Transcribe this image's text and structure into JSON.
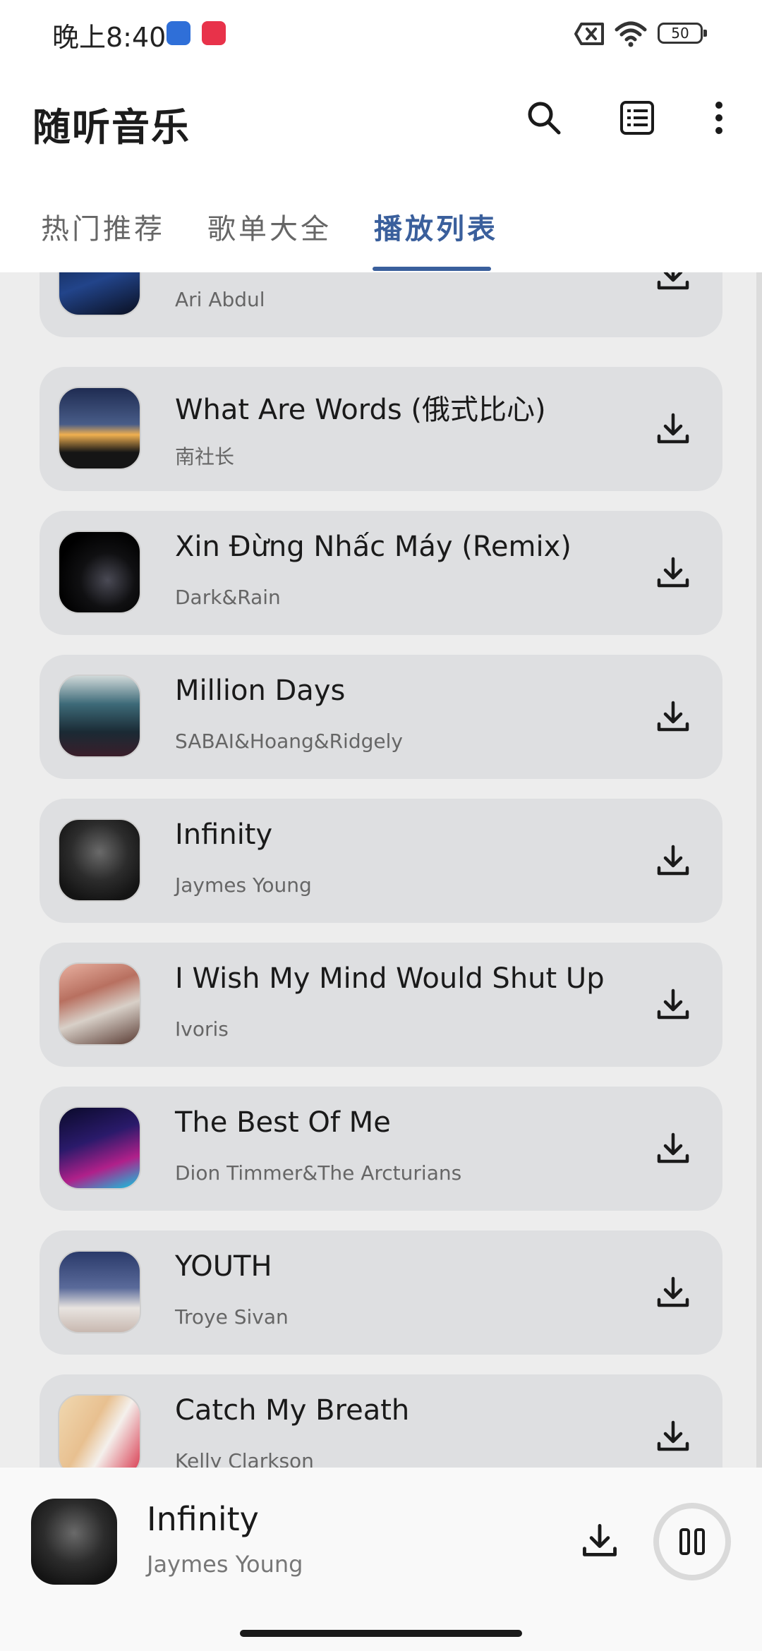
{
  "status_bar": {
    "time": "晚上8:40",
    "battery": "50"
  },
  "app": {
    "title": "随听音乐",
    "tabs": [
      {
        "label": "热门推荐"
      },
      {
        "label": "歌单大全"
      },
      {
        "label": "播放列表"
      }
    ],
    "active_tab": "播放列表"
  },
  "playlist": [
    {
      "title": "",
      "artist": "Ari Abdul"
    },
    {
      "title": "What Are Words (俄式比心)",
      "artist": "南社长"
    },
    {
      "title": "Xin Đừng Nhấc Máy (Remix)",
      "artist": "Dark&Rain"
    },
    {
      "title": "Million Days",
      "artist": "SABAI&Hoang&Ridgely"
    },
    {
      "title": "Infinity",
      "artist": "Jaymes Young"
    },
    {
      "title": "I Wish My Mind Would Shut Up",
      "artist": "Ivoris"
    },
    {
      "title": "The Best Of Me",
      "artist": "Dion Timmer&The Arcturians"
    },
    {
      "title": "YOUTH",
      "artist": "Troye Sivan"
    },
    {
      "title": "Catch My Breath",
      "artist": "Kelly Clarkson"
    }
  ],
  "now_playing": {
    "title": "Infinity",
    "artist": "Jaymes Young"
  },
  "colors": {
    "accent": "#3a5f9c",
    "card": "#dedfe1",
    "background": "#ededed"
  }
}
